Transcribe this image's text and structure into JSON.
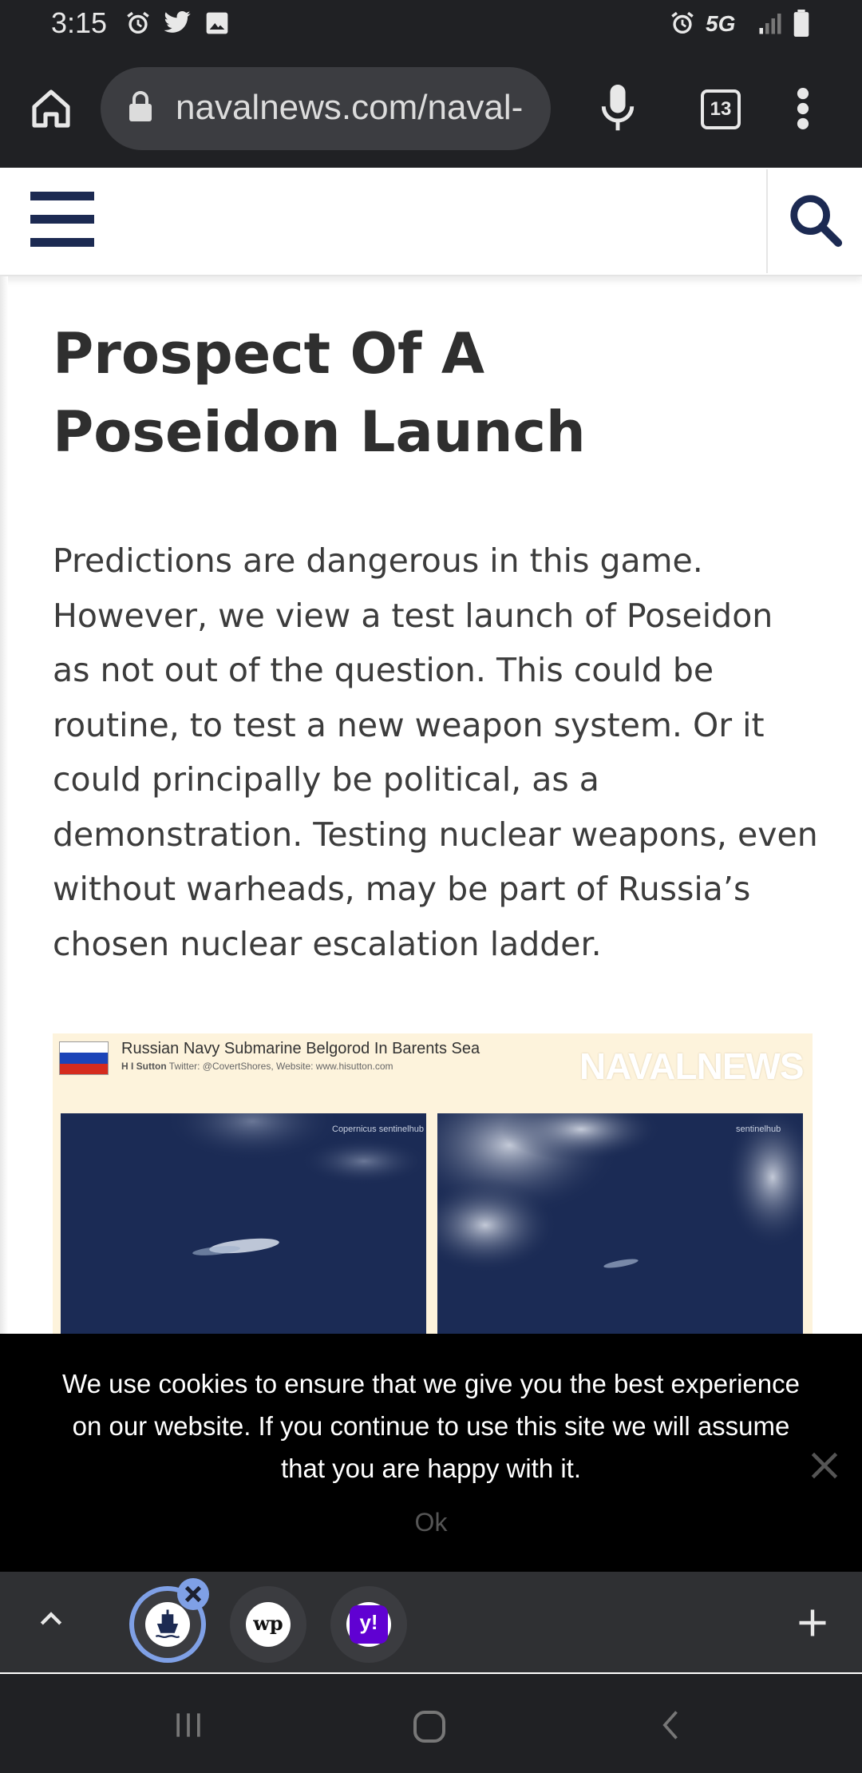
{
  "status_bar": {
    "time": "3:15",
    "network": "5G"
  },
  "browser": {
    "url": "navalnews.com/naval-",
    "tab_count": "13"
  },
  "article": {
    "title": "Prospect Of A Poseidon Launch",
    "body": "Predictions are dangerous in this game. However, we view a test launch of Poseidon as not out of the question. This could be routine, to test a new weapon system. Or it could principally be political, as a demonstration. Testing nuclear weapons, even without warheads, may be part of Russia’s chosen nuclear escalation ladder."
  },
  "figure": {
    "title": "Russian Navy Submarine Belgorod In Barents Sea",
    "author": "H I Sutton",
    "credits_line": "Twitter: @CovertShores, Website: www.hisutton.com",
    "logo": "NAVALNEWS",
    "left_credit": "Copernicus  sentinelhub",
    "right_credit": "sentinelhub"
  },
  "cookie_banner": {
    "message": "We use cookies to ensure that we give you the best experience on our website. If you continue to use this site we will assume that you are happy with it.",
    "ok_label": "Ok"
  },
  "colors": {
    "chrome_dark": "#202124",
    "site_navy": "#1c2a52",
    "figure_bg": "#fdf3dc",
    "cookie_bg": "#000000"
  }
}
